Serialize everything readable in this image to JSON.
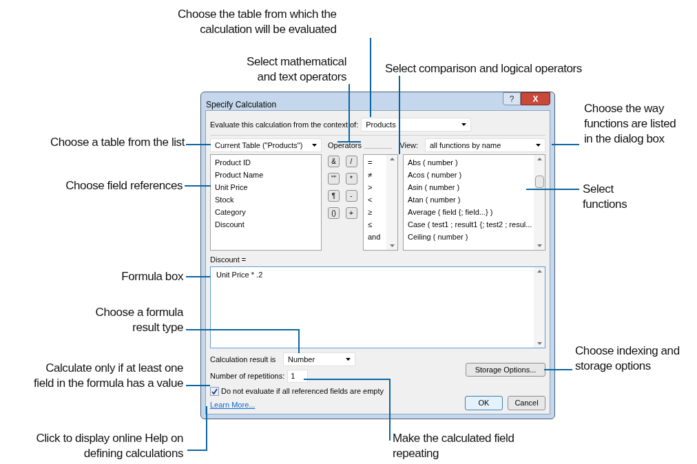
{
  "callouts": [
    {
      "text": "Choose the table from which the\ncalculation will be evaluated"
    },
    {
      "text": "Select mathematical\nand text operators"
    },
    {
      "text": "Select comparison and logical operators"
    },
    {
      "text": "Choose a table from the list"
    },
    {
      "text": "Choose field references"
    },
    {
      "text": "Formula box"
    },
    {
      "text": "Choose a formula\nresult type"
    },
    {
      "text": "Calculate only if at least one\nfield in the formula has a value"
    },
    {
      "text": "Click to display online Help on\ndefining calculations"
    },
    {
      "text": "Choose the way\nfunctions are listed\nin the dialog box"
    },
    {
      "text": "Select\nfunctions"
    },
    {
      "text": "Choose indexing and\nstorage options"
    },
    {
      "text": "Make the calculated field\nrepeating"
    }
  ],
  "dialog": {
    "title": "Specify Calculation",
    "help_button": "?",
    "close_button": "X",
    "context_label": "Evaluate this calculation from the context of:",
    "context_value": "Products",
    "table_selector": "Current Table (\"Products\")",
    "fields": [
      "Product ID",
      "Product Name",
      "Unit Price",
      "Stock",
      "Category",
      "Discount"
    ],
    "operators_label": "Operators",
    "operator_buttons": [
      "&",
      "/",
      "\"\"",
      "*",
      "¶",
      "-",
      "()",
      "+"
    ],
    "comparison_operators": [
      "=",
      "≠",
      ">",
      "<",
      "≥",
      "≤",
      "and"
    ],
    "view_label": "View:",
    "view_value": "all functions by name",
    "functions": [
      "Abs ( number )",
      "Acos ( number )",
      "Asin ( number )",
      "Atan ( number )",
      "Average ( field {; field...} )",
      "Case ( test1 ; result1 {; test2 ; resul...",
      "Ceiling ( number )"
    ],
    "formula_label": "Discount =",
    "formula": "Unit Price * .2",
    "result_label": "Calculation result is",
    "result_type": "Number",
    "repetitions_label": "Number of repetitions:",
    "repetitions": "1",
    "checkbox": {
      "label": "Do not evaluate if all referenced fields are empty",
      "checked": true
    },
    "learn_more": "Learn More...",
    "storage_button": "Storage Options...",
    "ok_button": "OK",
    "cancel_button": "Cancel"
  }
}
